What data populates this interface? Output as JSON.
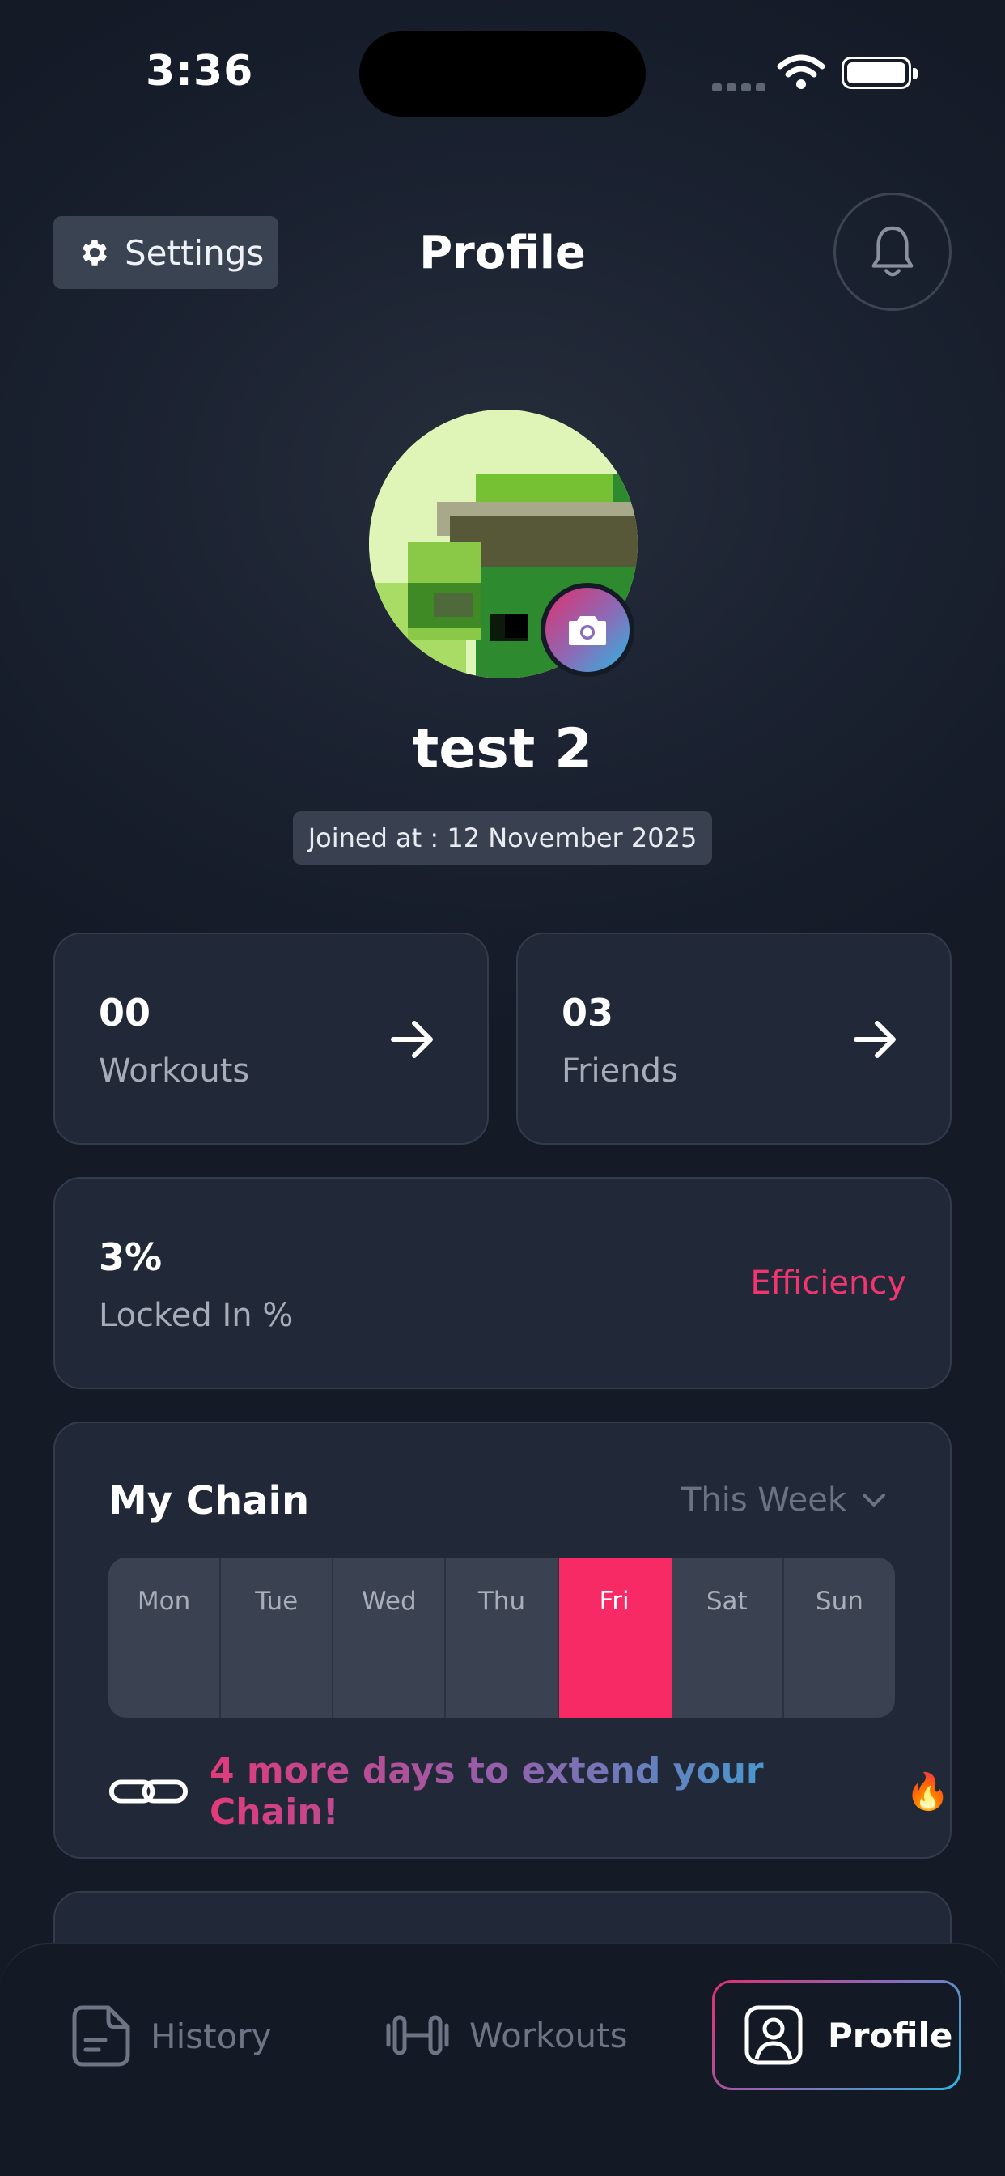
{
  "status_bar": {
    "time": "3:36"
  },
  "header": {
    "settings_label": "Settings",
    "title": "Profile"
  },
  "profile": {
    "username": "test 2",
    "joined": "Joined at : 12 November 2025"
  },
  "stats": {
    "workouts": {
      "value": "00",
      "label": "Workouts"
    },
    "friends": {
      "value": "03",
      "label": "Friends"
    },
    "locked_in": {
      "value": "3%",
      "label": "Locked In %",
      "tag": "Efficiency"
    }
  },
  "chain": {
    "title": "My Chain",
    "filter": "This Week",
    "days": [
      "Mon",
      "Tue",
      "Wed",
      "Thu",
      "Fri",
      "Sat",
      "Sun"
    ],
    "active_day": "Fri",
    "message": "4 more days to extend your Chain!",
    "flame": "🔥"
  },
  "nav": {
    "history": "History",
    "workouts": "Workouts",
    "profile": "Profile"
  },
  "colors": {
    "accent_pink": "#f72a66",
    "gradient_start": "#e0306f",
    "gradient_end": "#2bb6e0",
    "card_bg": "#212938"
  },
  "icons": {
    "settings": "gear-icon",
    "notifications": "bell-icon",
    "camera": "camera-icon",
    "arrow": "arrow-right-icon",
    "chain": "chain-link-icon",
    "history": "history-document-icon",
    "workouts": "dumbbell-icon",
    "profile": "user-icon"
  }
}
